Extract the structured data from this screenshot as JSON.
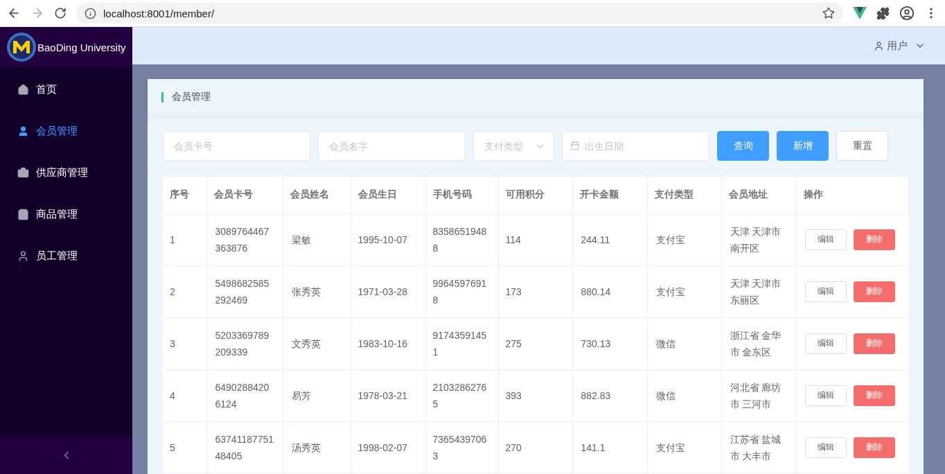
{
  "browser": {
    "url": "localhost:8001/member/"
  },
  "sidebar": {
    "brand": "BaoDing University",
    "items": [
      {
        "label": "首页",
        "selected": false
      },
      {
        "label": "会员管理",
        "selected": true
      },
      {
        "label": "供应商管理",
        "selected": false
      },
      {
        "label": "商品管理",
        "selected": false
      },
      {
        "label": "员工管理",
        "selected": false
      }
    ]
  },
  "header": {
    "user": "用户"
  },
  "card": {
    "title": "会员管理"
  },
  "filters": {
    "card_no": {
      "placeholder": "会员卡号"
    },
    "name": {
      "placeholder": "会员名字"
    },
    "pay_type": {
      "placeholder": "支付类型"
    },
    "birthday": {
      "placeholder": "出生日期"
    },
    "buttons": [
      {
        "label": "查询",
        "kind": "primary"
      },
      {
        "label": "新增",
        "kind": "primary"
      },
      {
        "label": "重置",
        "kind": "plain"
      }
    ]
  },
  "table": {
    "columns": [
      "序号",
      "会员卡号",
      "会员姓名",
      "会员生日",
      "手机号码",
      "可用积分",
      "开卡金额",
      "支付类型",
      "会员地址",
      "操作"
    ],
    "rows": [
      {
        "cells": [
          "1",
          "3089764467363876",
          "梁敏",
          "1995-10-07",
          "83586519488",
          "114",
          "244.11",
          "支付宝",
          "天津 天津市南开区"
        ],
        "actions": [
          "编辑",
          "删除"
        ]
      },
      {
        "cells": [
          "2",
          "5498682585292469",
          "张秀英",
          "1971-03-28",
          "99645976918",
          "173",
          "880.14",
          "支付宝",
          "天津 天津市东丽区"
        ],
        "actions": [
          "编辑",
          "删除"
        ]
      },
      {
        "cells": [
          "3",
          "5203369789209339",
          "文秀英",
          "1983-10-16",
          "91743591451",
          "275",
          "730.13",
          "微信",
          "浙江省 金华市 金东区"
        ],
        "actions": [
          "编辑",
          "删除"
        ]
      },
      {
        "cells": [
          "4",
          "64902884206124",
          "易芳",
          "1978-03-21",
          "21032862765",
          "393",
          "882.83",
          "微信",
          "河北省 廊坊市 三河市"
        ],
        "actions": [
          "编辑",
          "删除"
        ]
      },
      {
        "cells": [
          "5",
          "6374118775148405",
          "汤秀英",
          "1998-02-07",
          "73654397063",
          "270",
          "141.1",
          "支付宝",
          "江苏省 盐城市 大丰市"
        ],
        "actions": [
          "编辑",
          "删除"
        ]
      }
    ]
  }
}
